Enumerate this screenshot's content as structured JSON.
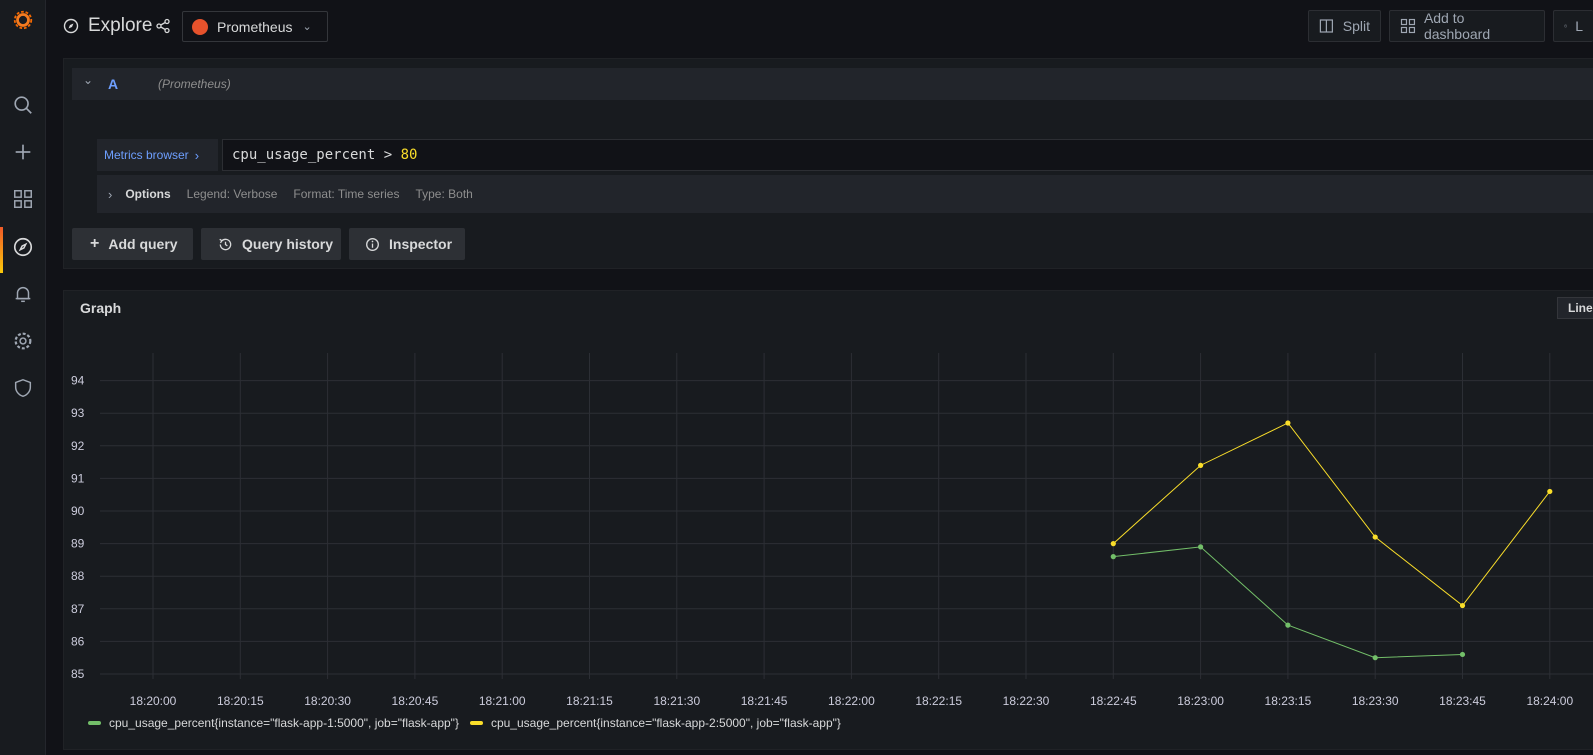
{
  "topbar": {
    "title": "Explore",
    "datasource": "Prometheus",
    "split_label": "Split",
    "add_to_dashboard_label": "Add to dashboard",
    "partial_button_label": "L"
  },
  "query": {
    "ref_id": "A",
    "datasource_hint": "(Prometheus)",
    "metrics_browser_label": "Metrics browser",
    "expression_metric": "cpu_usage_percent > ",
    "expression_value": "80",
    "options_label": "Options",
    "legend_option": "Legend: Verbose",
    "format_option": "Format: Time series",
    "type_option": "Type: Both",
    "add_query_label": "Add query",
    "query_history_label": "Query history",
    "inspector_label": "Inspector"
  },
  "graph": {
    "title": "Graph",
    "lines_toggle_label": "Lines"
  },
  "colors": {
    "series_green": "#73bf69",
    "series_yellow": "#fade2a",
    "accent_blue": "#6e9fff"
  },
  "chart_data": {
    "type": "line",
    "x": [
      "18:20:00",
      "18:20:15",
      "18:20:30",
      "18:20:45",
      "18:21:00",
      "18:21:15",
      "18:21:30",
      "18:21:45",
      "18:22:00",
      "18:22:15",
      "18:22:30",
      "18:22:45",
      "18:23:00",
      "18:23:15",
      "18:23:30",
      "18:23:45",
      "18:24:00"
    ],
    "yticks": [
      85,
      86,
      87,
      88,
      89,
      90,
      91,
      92,
      93,
      94
    ],
    "ylim": [
      84.8,
      95
    ],
    "series": [
      {
        "name": "cpu_usage_percent{instance=\"flask-app-1:5000\", job=\"flask-app\"}",
        "color": "#73bf69",
        "points": [
          [
            "18:22:45",
            88.6
          ],
          [
            "18:23:00",
            88.9
          ],
          [
            "18:23:15",
            86.5
          ],
          [
            "18:23:30",
            85.5
          ],
          [
            "18:23:45",
            85.6
          ]
        ]
      },
      {
        "name": "cpu_usage_percent{instance=\"flask-app-2:5000\", job=\"flask-app\"}",
        "color": "#fade2a",
        "points": [
          [
            "18:22:45",
            89.0
          ],
          [
            "18:23:00",
            91.4
          ],
          [
            "18:23:15",
            92.7
          ],
          [
            "18:23:30",
            89.2
          ],
          [
            "18:23:45",
            87.1
          ],
          [
            "18:24:00",
            90.6
          ]
        ]
      }
    ],
    "grid": true,
    "legend": "bottom-left"
  }
}
